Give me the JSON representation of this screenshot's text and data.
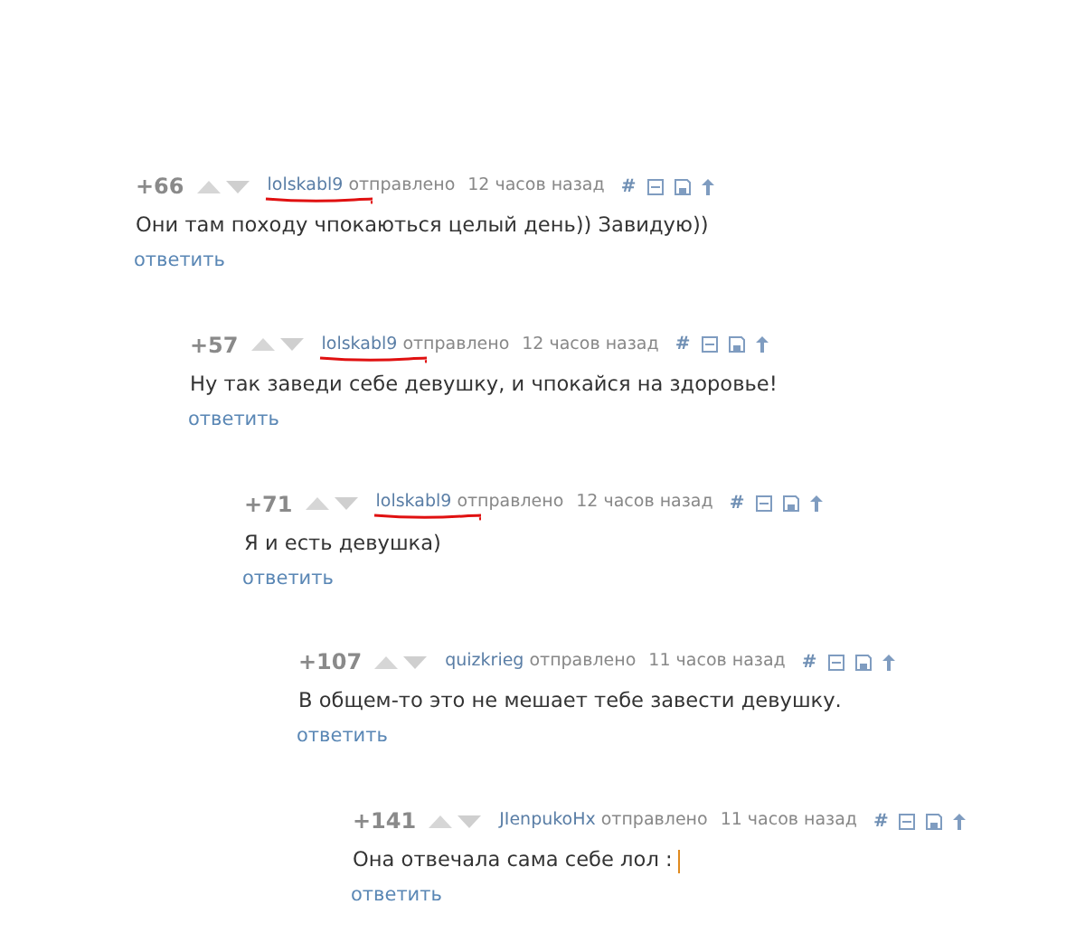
{
  "comments": [
    {
      "score": "+66",
      "author": "lolskabl9",
      "author_marked": true,
      "sent_label": "отправлено",
      "time": "12 часов назад",
      "hash": "#",
      "text": "Они там походу чпокаються целый день)) Завидую))",
      "cursor": false,
      "reply": "ответить",
      "children": [
        {
          "score": "+57",
          "author": "lolskabl9",
          "author_marked": true,
          "sent_label": "отправлено",
          "time": "12 часов назад",
          "hash": "#",
          "text": "Ну так заведи себе девушку, и чпокайся на здоровье!",
          "cursor": false,
          "reply": "ответить",
          "children": [
            {
              "score": "+71",
              "author": "lolskabl9",
              "author_marked": true,
              "sent_label": "отправлено",
              "time": "12 часов назад",
              "hash": "#",
              "text": "Я и есть девушка)",
              "cursor": false,
              "reply": "ответить",
              "children": [
                {
                  "score": "+107",
                  "author": "quizkrieg",
                  "author_marked": false,
                  "sent_label": "отправлено",
                  "time": "11 часов назад",
                  "hash": "#",
                  "text": "В общем-то это не мешает тебе завести девушку.",
                  "cursor": false,
                  "reply": "ответить",
                  "children": [
                    {
                      "score": "+141",
                      "author": "JIenpukoHx",
                      "author_marked": false,
                      "sent_label": "отправлено",
                      "time": "11 часов назад",
                      "hash": "#",
                      "text": "Она отвечала сама себе лол :",
                      "cursor": true,
                      "reply": "ответить"
                    }
                  ]
                }
              ]
            }
          ]
        }
      ]
    }
  ]
}
